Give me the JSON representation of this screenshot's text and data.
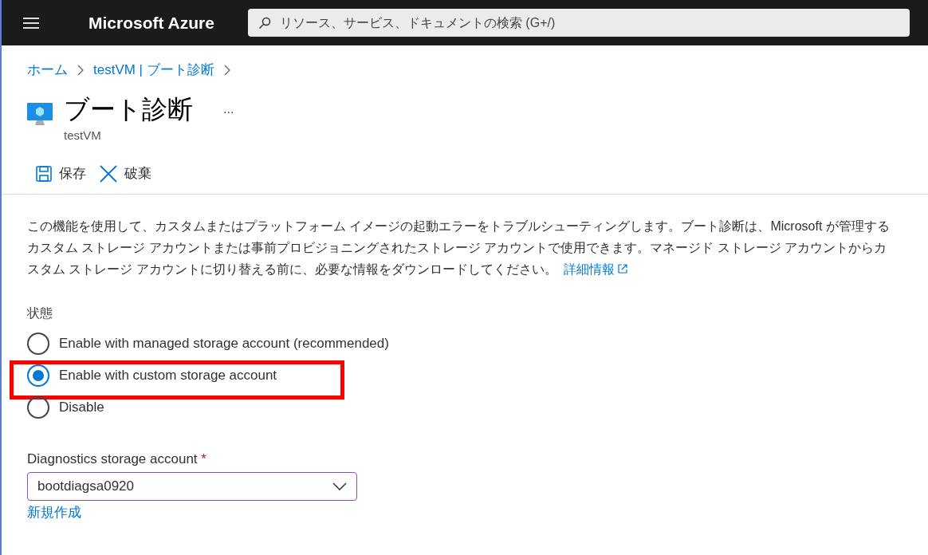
{
  "top_bar": {
    "brand": "Microsoft Azure",
    "search": {
      "placeholder": "リソース、サービス、ドキュメントの検索 (G+/)"
    }
  },
  "breadcrumb": [
    "ホーム",
    "testVM | ブート診断"
  ],
  "page": {
    "title": "ブート診断",
    "more": "...",
    "subtitle": "testVM"
  },
  "toolbar": [
    {
      "kind": "save",
      "label": "保存"
    },
    {
      "kind": "discard",
      "label": "破棄"
    }
  ],
  "description": {
    "text": "この機能を使用して、カスタムまたはプラットフォーム イメージの起動エラーをトラブルシューティングします。ブート診断は、Microsoft が管理するカスタム ストレージ アカウントまたは事前プロビジョニングされたストレージ アカウントで使用できます。マネージド ストレージ アカウントからカスタム ストレージ アカウントに切り替える前に、必要な情報をダウンロードしてください。",
    "link": "詳細情報"
  },
  "status": {
    "label": "状態",
    "options": [
      {
        "label": "Enable with managed storage account (recommended)",
        "selected": false,
        "highlighted": false
      },
      {
        "label": "Enable with custom storage account",
        "selected": true,
        "highlighted": true
      },
      {
        "label": "Disable",
        "selected": false,
        "highlighted": false
      }
    ]
  },
  "storage_account": {
    "label": "Diagnostics storage account",
    "required": "*",
    "value": "bootdiagsa0920",
    "create_link": "新規作成"
  }
}
